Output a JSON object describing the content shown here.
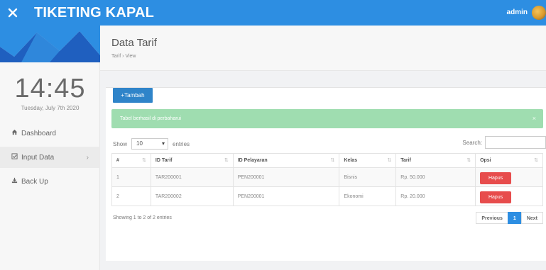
{
  "topbar": {
    "title": "TIKETING KAPAL",
    "user": "admin",
    "close_icon": "close-icon",
    "color": "#2d8ee2"
  },
  "sidebar": {
    "time": "14:45",
    "date": "Tuesday, July 7th 2020",
    "items": [
      {
        "label": "Dashboard",
        "icon": "home-icon"
      },
      {
        "label": "Input Data",
        "icon": "checkbox-icon",
        "chevron": "›"
      },
      {
        "label": "Back Up",
        "icon": "download-icon"
      }
    ]
  },
  "header": {
    "title": "Data Tarif",
    "breadcrumb": "Tarif › View"
  },
  "content": {
    "add_button": "+Tambah",
    "alert": "Tabel berhasil di perbaharui",
    "alert_close": "×",
    "show_label": "Show",
    "entries_value": "10",
    "entries_label": "entries",
    "search_label": "Search:",
    "search_value": "",
    "columns": [
      "#",
      "ID Tarif",
      "ID Pelayaran",
      "Kelas",
      "Tarif",
      "Opsi"
    ],
    "rows": [
      {
        "no": "1",
        "id_tarif": "TAR200001",
        "id_pelayaran": "PEN200001",
        "kelas": "Bisnis",
        "tarif": "Rp. 50.000",
        "action": "Hapus"
      },
      {
        "no": "2",
        "id_tarif": "TAR200002",
        "id_pelayaran": "PEN200001",
        "kelas": "Ekonomi",
        "tarif": "Rp. 20.000",
        "action": "Hapus"
      }
    ],
    "showing": "Showing 1 to 2 of 2 entries",
    "pager": {
      "previous": "Previous",
      "page": "1",
      "next": "Next"
    }
  },
  "colors": {
    "primary": "#2d8ee2",
    "danger": "#e74c4c",
    "success_alert": "#9fddb0"
  }
}
